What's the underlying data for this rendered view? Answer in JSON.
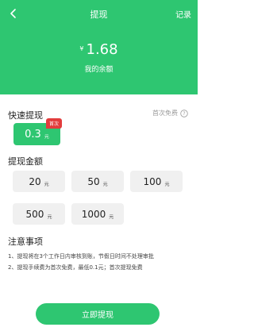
{
  "header": {
    "title": "提现",
    "records_label": "记录",
    "currency_symbol": "¥",
    "balance": "1.68",
    "balance_label": "我的余额"
  },
  "quick": {
    "title": "快速提现",
    "first_free_label": "首次免费",
    "option": {
      "value": "0.3",
      "unit": "元",
      "badge": "首次"
    }
  },
  "amounts": {
    "title": "提现金额",
    "items": [
      {
        "value": "20",
        "unit": "元"
      },
      {
        "value": "50",
        "unit": "元"
      },
      {
        "value": "100",
        "unit": "元"
      },
      {
        "value": "500",
        "unit": "元"
      },
      {
        "value": "1000",
        "unit": "元"
      }
    ]
  },
  "notes": {
    "title": "注意事项",
    "items": [
      "1、提现将在3个工作日内审核到账，节假日时间不处理审批",
      "2、提现手续费为首次免费，最低0.1元；首次提现免费"
    ]
  },
  "submit_label": "立即提现",
  "colors": {
    "accent": "#2ec671",
    "badge": "#e23c3c"
  }
}
